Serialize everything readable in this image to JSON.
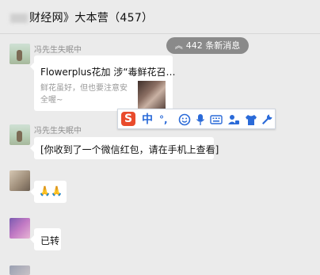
{
  "header": {
    "title": "财经网》大本营（457）"
  },
  "new_messages": {
    "label": "442 条新消息",
    "icon": "double-chevron-up-icon"
  },
  "messages": [
    {
      "sender": "冯先生失眠中",
      "card": {
        "title": "Flowerplus花加 涉“毒鲜花召…",
        "desc": "鲜花虽好，但也要注意安全喔~"
      }
    },
    {
      "sender": "冯先生失眠中",
      "text": "[你收到了一个微信红包，请在手机上查看]"
    },
    {
      "text": "🙏🙏"
    },
    {
      "text": "已转"
    }
  ],
  "ime_toolbar": {
    "logo": "S",
    "lang": "中",
    "punct": "°,",
    "icons": [
      "smiley-icon",
      "microphone-icon",
      "keyboard-icon",
      "user-card-icon",
      "lock-icon",
      "shirt-icon",
      "wrench-icon"
    ]
  },
  "colors": {
    "background": "#ebebeb",
    "badge": "#8a8a8a",
    "ime_blue": "#2a6ad8",
    "ime_logo": "#e94b2c"
  }
}
